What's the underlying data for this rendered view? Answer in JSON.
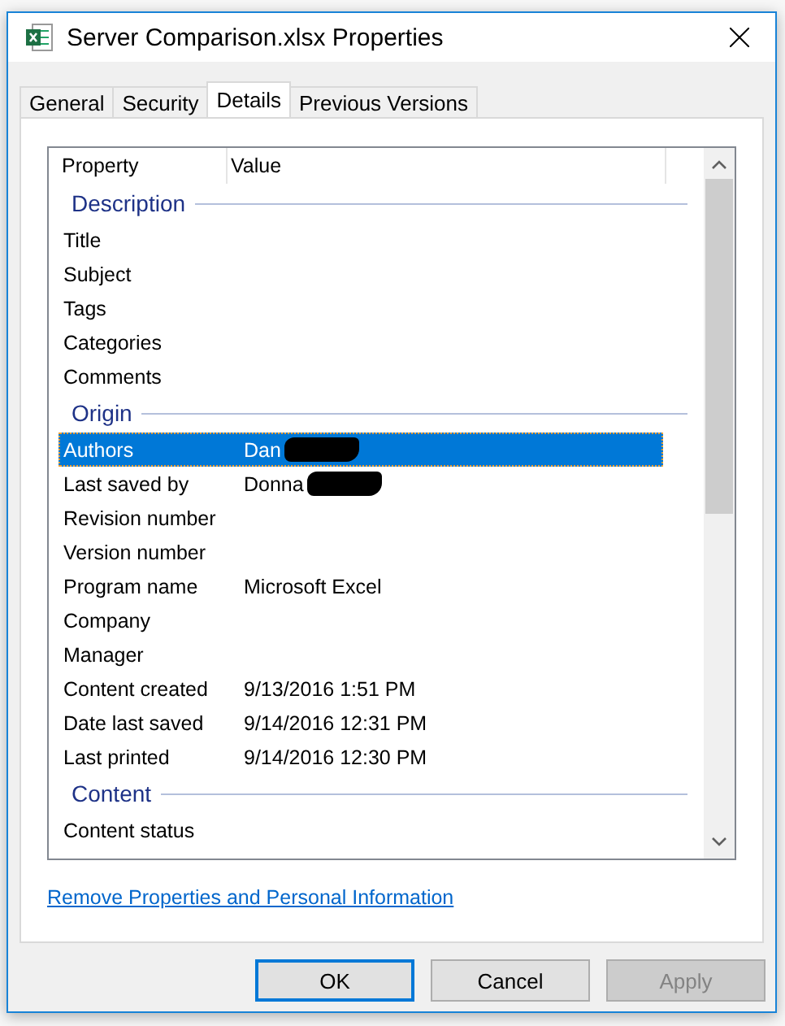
{
  "window": {
    "title": "Server Comparison.xlsx Properties"
  },
  "tabs": [
    {
      "label": "General",
      "selected": false
    },
    {
      "label": "Security",
      "selected": false
    },
    {
      "label": "Details",
      "selected": true
    },
    {
      "label": "Previous Versions",
      "selected": false
    }
  ],
  "list": {
    "columns": [
      "Property",
      "Value"
    ],
    "sections": [
      {
        "title": "Description",
        "rows": [
          {
            "name": "Title",
            "value": "",
            "selected": false,
            "redacted": false
          },
          {
            "name": "Subject",
            "value": "",
            "selected": false,
            "redacted": false
          },
          {
            "name": "Tags",
            "value": "",
            "selected": false,
            "redacted": false
          },
          {
            "name": "Categories",
            "value": "",
            "selected": false,
            "redacted": false
          },
          {
            "name": "Comments",
            "value": "",
            "selected": false,
            "redacted": false
          }
        ]
      },
      {
        "title": "Origin",
        "rows": [
          {
            "name": "Authors",
            "value": "Dan",
            "selected": true,
            "redacted": true
          },
          {
            "name": "Last saved by",
            "value": "Donna",
            "selected": false,
            "redacted": true
          },
          {
            "name": "Revision number",
            "value": "",
            "selected": false,
            "redacted": false
          },
          {
            "name": "Version number",
            "value": "",
            "selected": false,
            "redacted": false
          },
          {
            "name": "Program name",
            "value": "Microsoft Excel",
            "selected": false,
            "redacted": false
          },
          {
            "name": "Company",
            "value": "",
            "selected": false,
            "redacted": false
          },
          {
            "name": "Manager",
            "value": "",
            "selected": false,
            "redacted": false
          },
          {
            "name": "Content created",
            "value": "9/13/2016 1:51 PM",
            "selected": false,
            "redacted": false
          },
          {
            "name": "Date last saved",
            "value": "9/14/2016 12:31 PM",
            "selected": false,
            "redacted": false
          },
          {
            "name": "Last printed",
            "value": "9/14/2016 12:30 PM",
            "selected": false,
            "redacted": false
          }
        ]
      },
      {
        "title": "Content",
        "rows": [
          {
            "name": "Content status",
            "value": "",
            "selected": false,
            "redacted": false
          }
        ]
      }
    ]
  },
  "link": "Remove Properties and Personal Information",
  "buttons": [
    {
      "label": "OK",
      "kind": "default",
      "disabled": false
    },
    {
      "label": "Cancel",
      "kind": "normal",
      "disabled": false
    },
    {
      "label": "Apply",
      "kind": "normal",
      "disabled": true
    }
  ]
}
